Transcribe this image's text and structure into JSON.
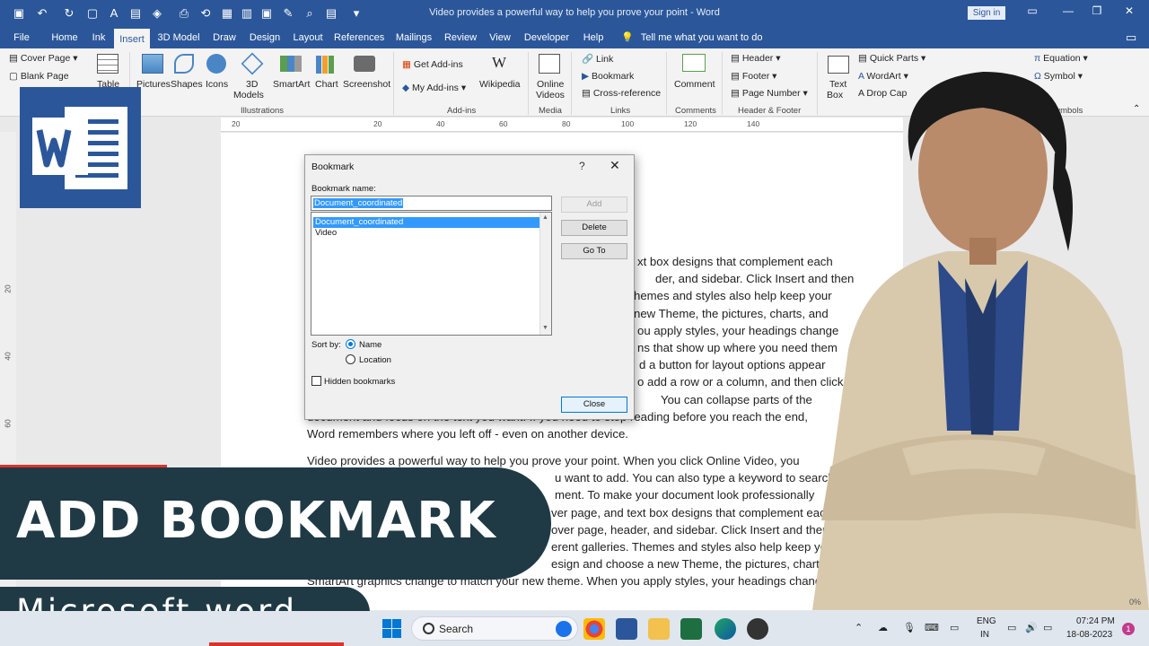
{
  "window": {
    "title": "Video provides a powerful way to help you prove your point  -  Word",
    "sign_in": "Sign in"
  },
  "tabs": [
    "File",
    "Home",
    "Ink",
    "Insert",
    "3D Model",
    "Draw",
    "Design",
    "Layout",
    "References",
    "Mailings",
    "Review",
    "View",
    "Developer",
    "Help"
  ],
  "active_tab": "Insert",
  "tell_me": "Tell me what you want to do",
  "ribbon": {
    "pages": {
      "cover_page": "Cover Page",
      "blank_page": "Blank Page"
    },
    "table": "Table",
    "illustrations": {
      "pictures": "Pictures",
      "shapes": "Shapes",
      "icons": "Icons",
      "models_3d_1": "3D",
      "models_3d_2": "Models",
      "smartart": "SmartArt",
      "chart": "Chart",
      "screenshot": "Screenshot",
      "group": "Illustrations"
    },
    "addins": {
      "get": "Get Add-ins",
      "my": "My Add-ins",
      "wikipedia": "Wikipedia",
      "group": "Add-ins"
    },
    "media": {
      "online1": "Online",
      "online2": "Videos",
      "group": "Media"
    },
    "links": {
      "link": "Link",
      "bookmark": "Bookmark",
      "cross": "Cross-reference",
      "group": "Links"
    },
    "comments": {
      "comment": "Comment",
      "group": "Comments"
    },
    "header_footer": {
      "header": "Header",
      "footer": "Footer",
      "page_number": "Page Number",
      "group": "Header & Footer"
    },
    "text": {
      "textbox1": "Text",
      "textbox2": "Box",
      "quick_parts": "Quick Parts",
      "wordart": "WordArt",
      "drop_cap": "Drop Cap"
    },
    "symbols": {
      "equation": "Equation",
      "symbol": "Symbol",
      "group": "Symbols"
    }
  },
  "ruler_ticks": [
    "20",
    "20",
    "40",
    "60",
    "80",
    "100",
    "120",
    "140"
  ],
  "left_ruler_ticks": [
    "20",
    "40",
    "60"
  ],
  "document_lines": [
    "xt box designs that complement each",
    "der, and sidebar. Click Insert and then",
    "hemes and styles also help keep your",
    "new Theme, the pictures, charts, and",
    "ou apply styles, your headings change",
    "ns that show up where you need them",
    "d a button for layout options appear",
    "o add a row or a column, and then click",
    "You can collapse parts of the",
    "document and focus on the text you want. If you need to stop reading before you reach the end,",
    "Word remembers where you left off - even on another device.",
    "Video provides a powerful way to help you prove your point. When you click Online Video, you",
    "u want to add. You can also type a keyword to search",
    "ment. To make your document look professionally",
    "ver page, and text box designs that complement each",
    "over page, header, and sidebar. Click Insert and then",
    "erent galleries. Themes and styles also help keep your",
    "esign and choose a new Theme, the pictures, charts, and",
    "SmartArt graphics change to match your new theme. When you apply styles, your headings change"
  ],
  "dialog": {
    "title": "Bookmark",
    "help": "?",
    "close_x": "✕",
    "name_label": "Bookmark name:",
    "name_value": "Document_coordinated",
    "items": [
      "Document_coordinated",
      "Video"
    ],
    "selected_index": 0,
    "buttons": {
      "add": "Add",
      "delete": "Delete",
      "goto": "Go To",
      "close": "Close"
    },
    "sort_by": "Sort by:",
    "sort_options": [
      "Name",
      "Location"
    ],
    "sort_selected": "Name",
    "hidden_bookmarks": "Hidden bookmarks",
    "hidden_checked": false
  },
  "overlay": {
    "headline": "ADD BOOKMARK",
    "subtitle": "Microsoft word"
  },
  "taskbar": {
    "search": "Search",
    "lang_1": "ENG",
    "lang_2": "IN",
    "time": "07:24 PM",
    "date": "18-08-2023",
    "notifications": "1",
    "zoom": "0%"
  },
  "colors": {
    "word_blue": "#2b579a",
    "banner": "#1f3a45",
    "accent_red": "#d9342b",
    "selection": "#3399ff"
  }
}
